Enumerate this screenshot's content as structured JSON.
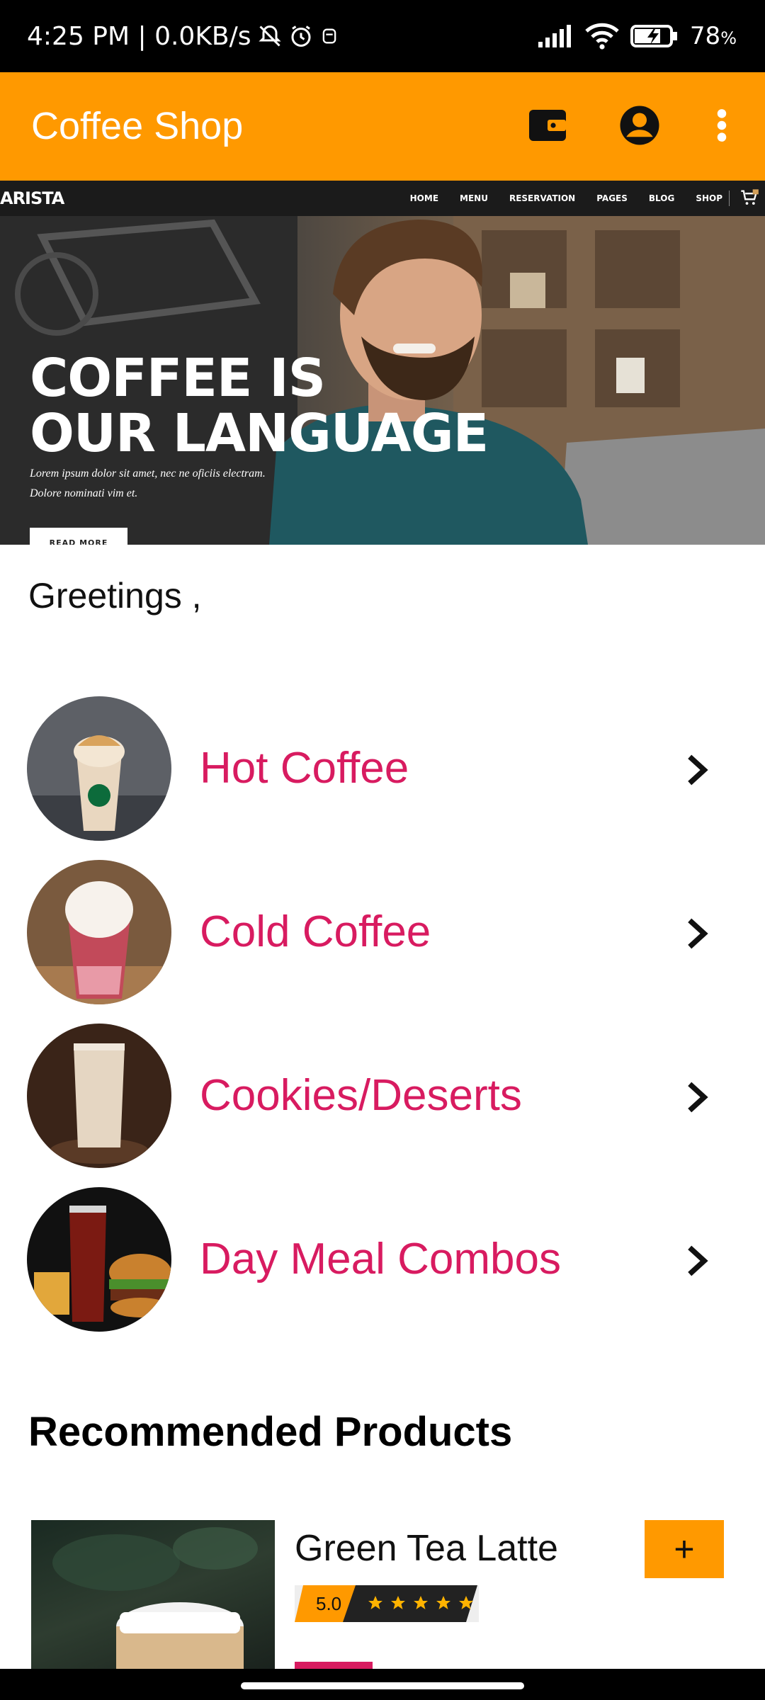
{
  "status_bar": {
    "time_speed": "4:25 PM | 0.0KB/s",
    "battery": "78",
    "battery_unit": "%"
  },
  "app_bar": {
    "title": "Coffee Shop",
    "wallet_icon": "wallet-icon",
    "account_icon": "account-circle-icon",
    "menu_icon": "more-vert-icon"
  },
  "banner": {
    "brand": "ARISTA",
    "nav": [
      "HOME",
      "MENU",
      "RESERVATION",
      "PAGES",
      "BLOG",
      "SHOP"
    ],
    "headline_1": "COFFEE IS",
    "headline_2": "OUR LANGUAGE",
    "sub_1": "Lorem ipsum dolor sit amet, nec ne oficiis electram.",
    "sub_2": "Dolore nominati vim et.",
    "button": "READ MORE"
  },
  "greeting": "Greetings ,",
  "categories": [
    {
      "label": "Hot Coffee"
    },
    {
      "label": "Cold Coffee"
    },
    {
      "label": "Cookies/Deserts"
    },
    {
      "label": "Day Meal Combos"
    }
  ],
  "recommended": {
    "title": "Recommended Products",
    "products": [
      {
        "name": "Green Tea Latte",
        "rating": "5.0",
        "stars": 5,
        "add_label": "+"
      }
    ]
  },
  "colors": {
    "accent": "#FF9900",
    "category_text": "#D81B60",
    "status_bar": "#000000"
  }
}
